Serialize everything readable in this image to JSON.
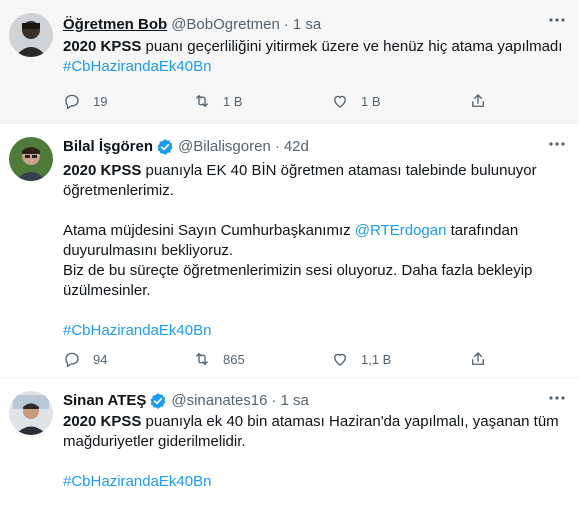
{
  "tweets": [
    {
      "name": "Öğretmen Bob",
      "handle": "@BobOgretmen",
      "time": "1 sa",
      "verified": false,
      "text_bold": "2020 KPSS",
      "text_rest": " puanı geçerliliğini yitirmek üzere ve henüz hiç atama yapılmadı",
      "hashtag": "#CbHazirandaEk40Bn",
      "replies": "19",
      "retweets": "1 B",
      "likes": "1 B"
    },
    {
      "name": "Bilal İşgören",
      "handle": "@Bilalisgoren",
      "time": "42d",
      "verified": true,
      "line1_bold": "2020 KPSS",
      "line1_rest": " puanıyla EK 40 BİN öğretmen ataması talebinde bulunuyor",
      "line2": "öğretmenlerimiz.",
      "line3_pre": "Atama müjdesini Sayın Cumhurbaşkanımız ",
      "line3_mention": "@RTErdogan",
      "line3_post": " tarafından",
      "line4": "duyurulmasını bekliyoruz.",
      "line5": "Biz de bu süreçte öğretmenlerimizin sesi oluyoruz. Daha fazla bekleyip",
      "line6": "üzülmesinler.",
      "hashtag": "#CbHazirandaEk40Bn",
      "replies": "94",
      "retweets": "865",
      "likes": "1,1 B"
    },
    {
      "name": "Sinan ATEŞ",
      "handle": "@sinanates16",
      "time": "1 sa",
      "verified": true,
      "line1_bold": "2020 KPSS",
      "line1_rest": " puanıyla ek 40 bin ataması Haziran'da yapılmalı, yaşanan tüm",
      "line2": "mağduriyetler giderilmelidir.",
      "hashtag": "#CbHazirandaEk40Bn"
    }
  ],
  "separator": "·",
  "colors": {
    "text": "#0f1419",
    "secondary": "#536471",
    "link": "#1d9bf0",
    "border": "#eff3f4",
    "hover_bg": "#f7f7f7"
  },
  "icons": {
    "reply": "reply-icon",
    "retweet": "retweet-icon",
    "like": "heart-icon",
    "share": "share-icon",
    "more": "more-icon",
    "verified": "verified-badge-icon"
  }
}
